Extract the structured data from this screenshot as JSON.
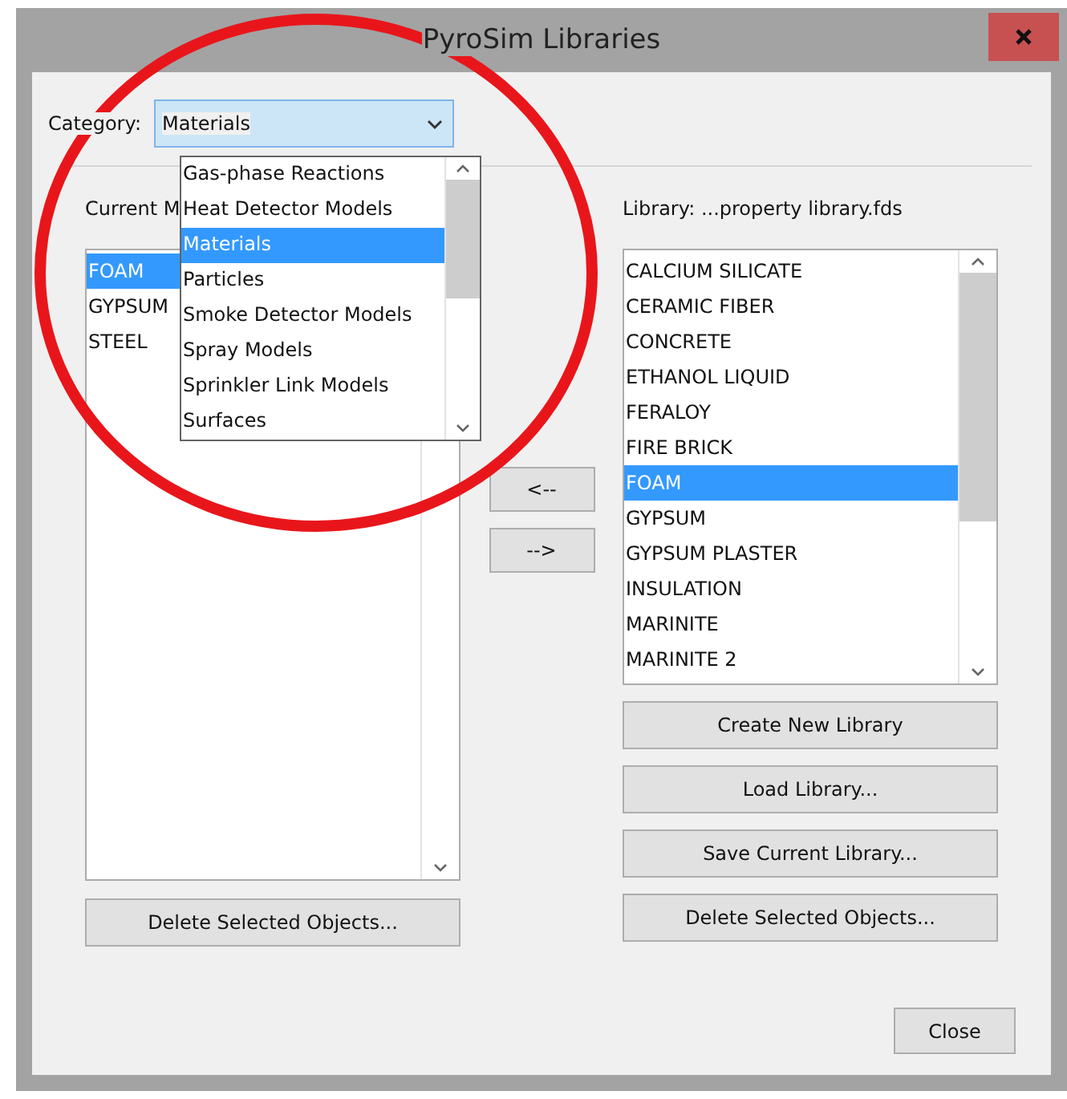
{
  "window": {
    "title": "PyroSim Libraries"
  },
  "category": {
    "label": "Category:",
    "value": "Materials",
    "expanded": true,
    "options": [
      {
        "label": "Gas-phase Reactions",
        "selected": false
      },
      {
        "label": "Heat Detector Models",
        "selected": false
      },
      {
        "label": "Materials",
        "selected": true
      },
      {
        "label": "Particles",
        "selected": false
      },
      {
        "label": "Smoke Detector Models",
        "selected": false
      },
      {
        "label": "Spray Models",
        "selected": false
      },
      {
        "label": "Sprinkler Link Models",
        "selected": false
      },
      {
        "label": "Surfaces",
        "selected": false
      }
    ]
  },
  "current": {
    "label": "Current M",
    "items": [
      {
        "label": "FOAM",
        "selected": true
      },
      {
        "label": "GYPSUM",
        "selected": false
      },
      {
        "label": "STEEL",
        "selected": false
      }
    ],
    "delete_button": "Delete Selected Objects..."
  },
  "transfer_buttons": [
    "<--",
    "-->"
  ],
  "library": {
    "label": "Library: ...property library.fds",
    "items": [
      {
        "label": "CALCIUM SILICATE",
        "selected": false
      },
      {
        "label": "CERAMIC FIBER",
        "selected": false
      },
      {
        "label": "CONCRETE",
        "selected": false
      },
      {
        "label": "ETHANOL LIQUID",
        "selected": false
      },
      {
        "label": "FERALOY",
        "selected": false
      },
      {
        "label": "FIRE BRICK",
        "selected": false
      },
      {
        "label": "FOAM",
        "selected": true
      },
      {
        "label": "GYPSUM",
        "selected": false
      },
      {
        "label": "GYPSUM PLASTER",
        "selected": false
      },
      {
        "label": "INSULATION",
        "selected": false
      },
      {
        "label": "MARINITE",
        "selected": false
      },
      {
        "label": "MARINITE 2",
        "selected": false
      }
    ],
    "buttons": [
      "Create New Library",
      "Load Library...",
      "Save Current Library...",
      "Delete Selected Objects..."
    ]
  },
  "close_button": "Close"
}
